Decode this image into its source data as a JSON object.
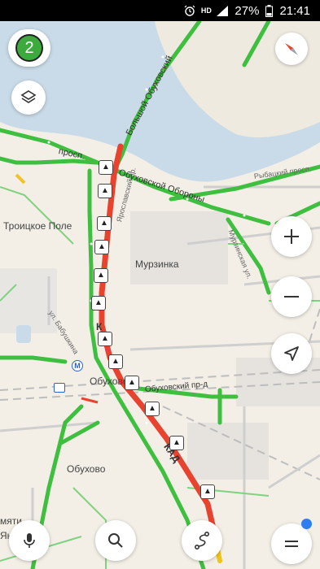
{
  "status_bar": {
    "alarm_icon": "alarm-clock-icon",
    "hd_label": "HD",
    "signal_icon": "signal-icon",
    "battery_percent": "27%",
    "battery_icon": "battery-icon",
    "time": "21:41"
  },
  "controls": {
    "traffic_score": "2",
    "traffic_color": "#3caa3c",
    "layers_icon": "layers-icon",
    "compass_icon": "compass-icon",
    "zoom_in_icon": "plus-icon",
    "zoom_out_icon": "minus-icon",
    "location_icon": "navigation-arrow-icon",
    "voice_icon": "microphone-icon",
    "search_icon": "search-icon",
    "route_icon": "route-icon",
    "menu_icon": "menu-icon",
    "notification_color": "#2d7ef2"
  },
  "map": {
    "places": {
      "troitskoe_pole": "Троицкое Поле",
      "murzinka": "Мурзинка",
      "obukhovo_station": "Обухово",
      "obukhovo_district": "Обухово",
      "pamyati_left_top": "мяти",
      "pamyati_left_bottom": "Января"
    },
    "streets": {
      "bolshoy_obukhovsky": "Большой Обуховский",
      "prosp_left": "просп.",
      "obukhovskoy_oborony": "Обуховской Обороны",
      "rybatsky_prosp": "Рыбацкий просп.",
      "murzinskaya": "Мурзинская ул.",
      "yaroslavsky": "Ярославский пр.",
      "babushkina": "ул. Бабушкина",
      "obukhovsky_pr": "Обуховский пр-д",
      "kad": "КАД",
      "kamyshovaya": "К"
    },
    "metro_icon": "metro-icon",
    "train_icon": "train-station-icon",
    "jam_icon": "traffic-jam-icon",
    "colors": {
      "water": "#c9dbe8",
      "land": "#f3efe6",
      "green_road": "#3fbf3f",
      "red_road": "#e8432e",
      "yellow_road": "#f0c419"
    }
  }
}
